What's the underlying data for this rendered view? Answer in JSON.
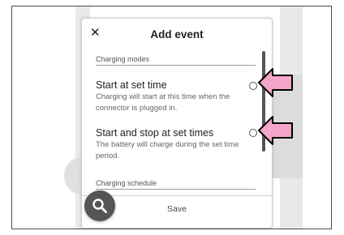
{
  "dialog": {
    "close_glyph": "✕",
    "title": "Add event",
    "section_modes": "Charging modes",
    "options": [
      {
        "title": "Start at set time",
        "description": "Charging will  start at this time when the connector is plugged in."
      },
      {
        "title": "Start and stop at set times",
        "description": "The battery will charge during the set time period."
      }
    ],
    "section_schedule": "Charging schedule",
    "save_label": "Save"
  },
  "icons": {
    "close": "close-icon",
    "fab": "search-icon",
    "callout": "arrow-pointer-icon"
  },
  "colors": {
    "arrow_fill": "#f4a6c8",
    "arrow_stroke": "#000000",
    "fab_background": "#555557",
    "scrollbar": "#555555"
  }
}
